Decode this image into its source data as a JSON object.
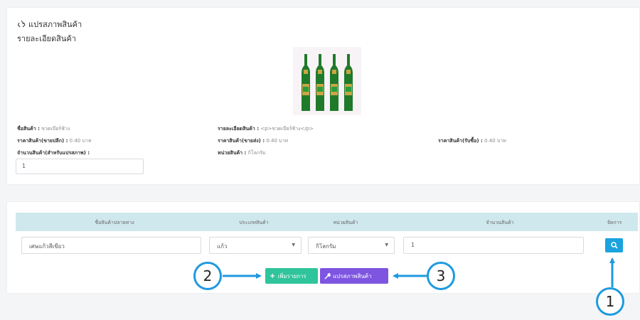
{
  "header": {
    "title": "แปรสภาพสินค้า",
    "subtitle": "รายละเอียดสินค้า",
    "title_icon": "recycle-icon"
  },
  "product": {
    "name_label": "ชื่อสินค้า :",
    "name_value": "ขวดเบียร์ช้าง",
    "detail_label": "รายละเอียดสินค้า :",
    "detail_value": "<p>ขวดเบียร์ช้าง</p>",
    "retail_label": "ราคาสินค้า(ขายปลีก) :",
    "retail_value": "0.40 บาท",
    "wholesale_label": "ราคาสินค้า(ขายส่ง) :",
    "wholesale_value": "0.40 บาท",
    "buy_label": "ราคาสินค้า(รับซื้อ) :",
    "buy_value": "0.40 บาท",
    "convert_qty_label": "จำนวนสินค้า(สำหรับแปรสภาพ) :",
    "unit_label": "หน่วยสินค้า :",
    "unit_value": "กิโลกรัม",
    "convert_qty_value": "1"
  },
  "table": {
    "headers": [
      "ชื่อสินค้าปลายทาง",
      "ประเภทสินค้า",
      "หน่วยสินค้า",
      "จำนวนสินค้า",
      "จัดการ"
    ],
    "row": {
      "name": "เศษแก้วสีเขียว",
      "type": "แก้ว",
      "unit": "กิโลกรัม",
      "qty": "1"
    }
  },
  "actions": {
    "add_label": "เพิ่มรายการ",
    "convert_label": "แปรสภาพสินค้า"
  },
  "callouts": [
    "1",
    "2",
    "3"
  ],
  "colors": {
    "add": "#2fc49b",
    "convert": "#7d55e0",
    "search": "#1aa3de",
    "callout": "#1e9ae0",
    "table_head": "#cfe8ee"
  }
}
